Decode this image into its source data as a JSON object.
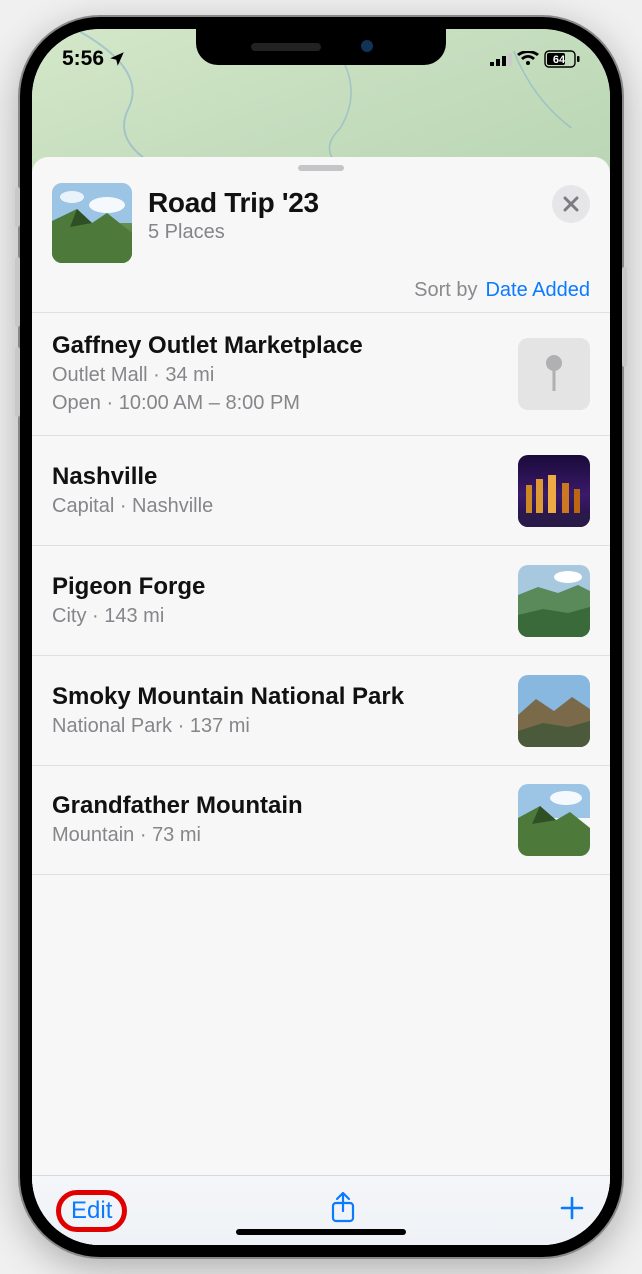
{
  "status": {
    "time": "5:56",
    "battery": "64"
  },
  "header": {
    "title": "Road Trip '23",
    "subtitle": "5 Places"
  },
  "sort": {
    "label": "Sort by",
    "value": "Date Added"
  },
  "places": [
    {
      "name": "Gaffney Outlet Marketplace",
      "type": "Outlet Mall",
      "distance": "34 mi",
      "status": "Open",
      "hours": "10:00 AM – 8:00 PM",
      "thumb": "pin"
    },
    {
      "name": "Nashville",
      "type": "Capital",
      "extra": "Nashville",
      "thumb": "city-night"
    },
    {
      "name": "Pigeon Forge",
      "type": "City",
      "distance": "143 mi",
      "thumb": "valley"
    },
    {
      "name": "Smoky Mountain National Park",
      "type": "National Park",
      "distance": "137 mi",
      "thumb": "mountains"
    },
    {
      "name": "Grandfather Mountain",
      "type": "Mountain",
      "distance": "73 mi",
      "thumb": "peak"
    }
  ],
  "toolbar": {
    "edit": "Edit"
  }
}
